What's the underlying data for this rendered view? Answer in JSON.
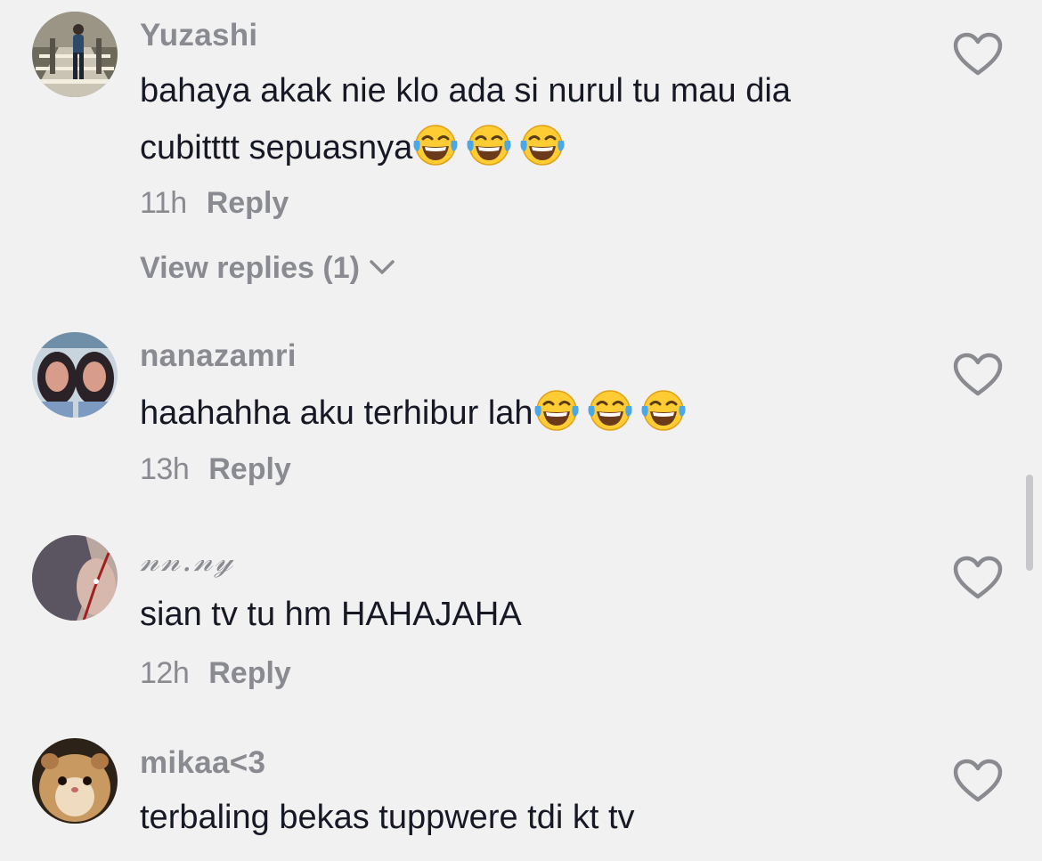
{
  "colors": {
    "background": "#f1f1f2",
    "username": "#8a8b91",
    "text": "#161823",
    "meta": "#8a8b91",
    "heart_outline": "#8a8b91"
  },
  "icons": {
    "like": "heart-outline-icon",
    "expand": "chevron-down-icon",
    "emoji": "face-with-tears-of-joy-emoji"
  },
  "comments": [
    {
      "username": "Yuzashi",
      "text_line1": "bahaya akak nie klo ada si nurul tu mau dia",
      "text_line2": "cubitttt sepuasnya",
      "emoji_count": 3,
      "time": "11h",
      "reply_label": "Reply",
      "view_replies_label": "View replies (1)"
    },
    {
      "username": "nanazamri",
      "text_line1": "haahahha aku terhibur lah",
      "emoji_count": 3,
      "time": "13h",
      "reply_label": "Reply"
    },
    {
      "username": "𝓃𝓃.𝓃𝓎",
      "text_line1": "sian tv tu hm HAHAJAHA",
      "time": "12h",
      "reply_label": "Reply"
    },
    {
      "username": "mikaa<3",
      "text_line1": "terbaling bekas tuppwere tdi kt tv"
    }
  ]
}
